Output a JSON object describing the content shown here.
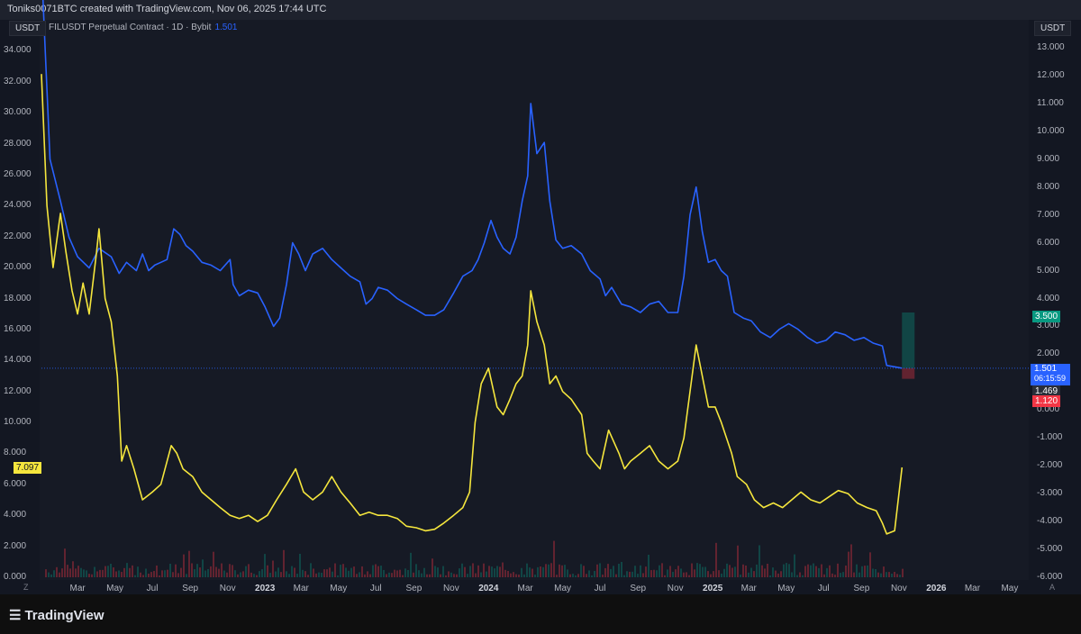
{
  "header": {
    "text": "Toniks0071BTC created with TradingView.com, Nov 06, 2025 17:44 UTC"
  },
  "symbol": {
    "name": "FILUSDT Perpetual Contract · 1D · Bybit",
    "last": "1.501"
  },
  "left_axis": {
    "unit": "USDT",
    "ticks": [
      "34.000",
      "32.000",
      "30.000",
      "28.000",
      "26.000",
      "24.000",
      "22.000",
      "20.000",
      "18.000",
      "16.000",
      "14.000",
      "12.000",
      "10.000",
      "8.000",
      "6.000",
      "4.000",
      "2.000",
      "0.000"
    ]
  },
  "right_axis": {
    "unit": "USDT",
    "ticks": [
      "13.000",
      "12.000",
      "11.000",
      "10.000",
      "9.000",
      "8.000",
      "7.000",
      "6.000",
      "5.000",
      "4.000",
      "3.000",
      "2.000",
      "1.000",
      "0.000",
      "-1.000",
      "-2.000",
      "-3.000",
      "-4.000",
      "-5.000",
      "-6.000"
    ]
  },
  "x_axis": {
    "corner_left": "Z",
    "corner_right": "A",
    "labels": [
      {
        "t": "Mar",
        "bold": false
      },
      {
        "t": "May",
        "bold": false
      },
      {
        "t": "Jul",
        "bold": false
      },
      {
        "t": "Sep",
        "bold": false
      },
      {
        "t": "Nov",
        "bold": false
      },
      {
        "t": "2023",
        "bold": true
      },
      {
        "t": "Mar",
        "bold": false
      },
      {
        "t": "May",
        "bold": false
      },
      {
        "t": "Jul",
        "bold": false
      },
      {
        "t": "Sep",
        "bold": false
      },
      {
        "t": "Nov",
        "bold": false
      },
      {
        "t": "2024",
        "bold": true
      },
      {
        "t": "Mar",
        "bold": false
      },
      {
        "t": "May",
        "bold": false
      },
      {
        "t": "Jul",
        "bold": false
      },
      {
        "t": "Sep",
        "bold": false
      },
      {
        "t": "Nov",
        "bold": false
      },
      {
        "t": "2025",
        "bold": true
      },
      {
        "t": "Mar",
        "bold": false
      },
      {
        "t": "May",
        "bold": false
      },
      {
        "t": "Jul",
        "bold": false
      },
      {
        "t": "Sep",
        "bold": false
      },
      {
        "t": "Nov",
        "bold": false
      },
      {
        "t": "2026",
        "bold": true
      },
      {
        "t": "Mar",
        "bold": false
      },
      {
        "t": "May",
        "bold": false
      }
    ]
  },
  "badges": {
    "left_yellow": "7.097",
    "target": "3.500",
    "price": "1.501",
    "countdown": "06:15:59",
    "entry": "1.469",
    "stop": "1.120"
  },
  "colors": {
    "blue": "#2962ff",
    "yellow": "#f5e63d",
    "green": "#089981",
    "red": "#f23645",
    "bg": "#131722"
  },
  "footer": {
    "brand": "TradingView"
  },
  "chart_data": {
    "type": "line",
    "x_range": [
      "2022-01-01",
      "2026-06-01"
    ],
    "series": [
      {
        "name": "FILUSDT Perpetual Contract · 1D · Bybit",
        "axis": "right",
        "points": [
          [
            "2022-01-01",
            16.0
          ],
          [
            "2022-01-15",
            9.0
          ],
          [
            "2022-02-01",
            7.5
          ],
          [
            "2022-02-15",
            6.2
          ],
          [
            "2022-03-01",
            5.5
          ],
          [
            "2022-03-20",
            5.1
          ],
          [
            "2022-04-05",
            5.8
          ],
          [
            "2022-04-25",
            5.5
          ],
          [
            "2022-05-08",
            4.9
          ],
          [
            "2022-05-20",
            5.3
          ],
          [
            "2022-06-05",
            5.0
          ],
          [
            "2022-06-15",
            5.6
          ],
          [
            "2022-06-25",
            5.0
          ],
          [
            "2022-07-05",
            5.2
          ],
          [
            "2022-07-15",
            5.3
          ],
          [
            "2022-07-25",
            5.4
          ],
          [
            "2022-08-05",
            6.5
          ],
          [
            "2022-08-15",
            6.3
          ],
          [
            "2022-08-25",
            5.9
          ],
          [
            "2022-09-05",
            5.7
          ],
          [
            "2022-09-20",
            5.3
          ],
          [
            "2022-10-05",
            5.2
          ],
          [
            "2022-10-20",
            5.0
          ],
          [
            "2022-11-05",
            5.4
          ],
          [
            "2022-11-10",
            4.5
          ],
          [
            "2022-11-20",
            4.1
          ],
          [
            "2022-12-05",
            4.3
          ],
          [
            "2022-12-20",
            4.2
          ],
          [
            "2023-01-01",
            3.7
          ],
          [
            "2023-01-15",
            3.0
          ],
          [
            "2023-01-25",
            3.3
          ],
          [
            "2023-02-05",
            4.5
          ],
          [
            "2023-02-15",
            6.0
          ],
          [
            "2023-02-25",
            5.6
          ],
          [
            "2023-03-08",
            5.0
          ],
          [
            "2023-03-20",
            5.6
          ],
          [
            "2023-04-05",
            5.8
          ],
          [
            "2023-04-20",
            5.4
          ],
          [
            "2023-05-05",
            5.1
          ],
          [
            "2023-05-20",
            4.8
          ],
          [
            "2023-06-05",
            4.6
          ],
          [
            "2023-06-15",
            3.8
          ],
          [
            "2023-06-25",
            4.0
          ],
          [
            "2023-07-05",
            4.4
          ],
          [
            "2023-07-20",
            4.3
          ],
          [
            "2023-08-05",
            4.0
          ],
          [
            "2023-08-20",
            3.8
          ],
          [
            "2023-09-05",
            3.6
          ],
          [
            "2023-09-20",
            3.4
          ],
          [
            "2023-10-05",
            3.4
          ],
          [
            "2023-10-20",
            3.6
          ],
          [
            "2023-11-05",
            4.2
          ],
          [
            "2023-11-20",
            4.8
          ],
          [
            "2023-12-05",
            5.0
          ],
          [
            "2023-12-15",
            5.4
          ],
          [
            "2023-12-25",
            6.0
          ],
          [
            "2024-01-05",
            6.8
          ],
          [
            "2024-01-15",
            6.2
          ],
          [
            "2024-01-25",
            5.8
          ],
          [
            "2024-02-05",
            5.6
          ],
          [
            "2024-02-15",
            6.2
          ],
          [
            "2024-02-25",
            7.5
          ],
          [
            "2024-03-05",
            8.4
          ],
          [
            "2024-03-10",
            11.0
          ],
          [
            "2024-03-20",
            9.2
          ],
          [
            "2024-04-01",
            9.6
          ],
          [
            "2024-04-10",
            7.5
          ],
          [
            "2024-04-20",
            6.1
          ],
          [
            "2024-05-01",
            5.8
          ],
          [
            "2024-05-15",
            5.9
          ],
          [
            "2024-06-01",
            5.6
          ],
          [
            "2024-06-15",
            5.0
          ],
          [
            "2024-07-01",
            4.7
          ],
          [
            "2024-07-10",
            4.1
          ],
          [
            "2024-07-20",
            4.4
          ],
          [
            "2024-08-05",
            3.8
          ],
          [
            "2024-08-20",
            3.7
          ],
          [
            "2024-09-05",
            3.5
          ],
          [
            "2024-09-20",
            3.8
          ],
          [
            "2024-10-05",
            3.9
          ],
          [
            "2024-10-20",
            3.5
          ],
          [
            "2024-11-05",
            3.5
          ],
          [
            "2024-11-15",
            4.8
          ],
          [
            "2024-11-25",
            7.0
          ],
          [
            "2024-12-05",
            8.0
          ],
          [
            "2024-12-15",
            6.4
          ],
          [
            "2024-12-25",
            5.3
          ],
          [
            "2025-01-05",
            5.4
          ],
          [
            "2025-01-15",
            5.0
          ],
          [
            "2025-01-25",
            4.8
          ],
          [
            "2025-02-05",
            3.5
          ],
          [
            "2025-02-20",
            3.3
          ],
          [
            "2025-03-05",
            3.2
          ],
          [
            "2025-03-20",
            2.8
          ],
          [
            "2025-04-05",
            2.6
          ],
          [
            "2025-04-20",
            2.9
          ],
          [
            "2025-05-05",
            3.1
          ],
          [
            "2025-05-20",
            2.9
          ],
          [
            "2025-06-05",
            2.6
          ],
          [
            "2025-06-20",
            2.4
          ],
          [
            "2025-07-05",
            2.5
          ],
          [
            "2025-07-20",
            2.8
          ],
          [
            "2025-08-05",
            2.7
          ],
          [
            "2025-08-20",
            2.5
          ],
          [
            "2025-09-05",
            2.6
          ],
          [
            "2025-09-20",
            2.4
          ],
          [
            "2025-10-05",
            2.3
          ],
          [
            "2025-10-12",
            1.6
          ],
          [
            "2025-10-25",
            1.55
          ],
          [
            "2025-11-06",
            1.501
          ]
        ]
      },
      {
        "name": "",
        "axis": "left",
        "points": [
          [
            "2022-01-01",
            32.5
          ],
          [
            "2022-01-10",
            24.0
          ],
          [
            "2022-01-20",
            20.0
          ],
          [
            "2022-02-01",
            23.5
          ],
          [
            "2022-02-10",
            21.0
          ],
          [
            "2022-02-20",
            18.5
          ],
          [
            "2022-03-01",
            17.0
          ],
          [
            "2022-03-10",
            19.0
          ],
          [
            "2022-03-20",
            17.0
          ],
          [
            "2022-04-01",
            21.0
          ],
          [
            "2022-04-05",
            22.5
          ],
          [
            "2022-04-15",
            18.0
          ],
          [
            "2022-04-25",
            16.5
          ],
          [
            "2022-05-05",
            13.0
          ],
          [
            "2022-05-12",
            7.5
          ],
          [
            "2022-05-20",
            8.5
          ],
          [
            "2022-06-01",
            7.0
          ],
          [
            "2022-06-15",
            5.0
          ],
          [
            "2022-07-01",
            5.5
          ],
          [
            "2022-07-15",
            6.0
          ],
          [
            "2022-08-01",
            8.5
          ],
          [
            "2022-08-10",
            8.0
          ],
          [
            "2022-08-20",
            7.0
          ],
          [
            "2022-09-05",
            6.5
          ],
          [
            "2022-09-20",
            5.5
          ],
          [
            "2022-10-05",
            5.0
          ],
          [
            "2022-10-20",
            4.5
          ],
          [
            "2022-11-05",
            4.0
          ],
          [
            "2022-11-20",
            3.8
          ],
          [
            "2022-12-05",
            4.0
          ],
          [
            "2022-12-20",
            3.6
          ],
          [
            "2023-01-05",
            4.0
          ],
          [
            "2023-01-20",
            5.0
          ],
          [
            "2023-02-05",
            6.0
          ],
          [
            "2023-02-20",
            7.0
          ],
          [
            "2023-03-05",
            5.5
          ],
          [
            "2023-03-20",
            5.0
          ],
          [
            "2023-04-05",
            5.5
          ],
          [
            "2023-04-20",
            6.5
          ],
          [
            "2023-05-05",
            5.5
          ],
          [
            "2023-05-20",
            4.8
          ],
          [
            "2023-06-05",
            4.0
          ],
          [
            "2023-06-20",
            4.2
          ],
          [
            "2023-07-05",
            4.0
          ],
          [
            "2023-07-20",
            4.0
          ],
          [
            "2023-08-05",
            3.8
          ],
          [
            "2023-08-20",
            3.3
          ],
          [
            "2023-09-05",
            3.2
          ],
          [
            "2023-09-20",
            3.0
          ],
          [
            "2023-10-05",
            3.1
          ],
          [
            "2023-10-20",
            3.5
          ],
          [
            "2023-11-05",
            4.0
          ],
          [
            "2023-11-20",
            4.5
          ],
          [
            "2023-12-01",
            5.5
          ],
          [
            "2023-12-10",
            10.0
          ],
          [
            "2023-12-20",
            12.5
          ],
          [
            "2024-01-01",
            13.5
          ],
          [
            "2024-01-15",
            11.0
          ],
          [
            "2024-01-25",
            10.5
          ],
          [
            "2024-02-05",
            11.5
          ],
          [
            "2024-02-15",
            12.5
          ],
          [
            "2024-02-25",
            13.0
          ],
          [
            "2024-03-05",
            15.0
          ],
          [
            "2024-03-10",
            18.5
          ],
          [
            "2024-03-20",
            16.5
          ],
          [
            "2024-04-01",
            15.0
          ],
          [
            "2024-04-10",
            12.5
          ],
          [
            "2024-04-20",
            13.0
          ],
          [
            "2024-05-01",
            12.0
          ],
          [
            "2024-05-15",
            11.5
          ],
          [
            "2024-06-01",
            10.5
          ],
          [
            "2024-06-10",
            8.0
          ],
          [
            "2024-06-20",
            7.5
          ],
          [
            "2024-07-01",
            7.0
          ],
          [
            "2024-07-15",
            9.5
          ],
          [
            "2024-08-01",
            8.0
          ],
          [
            "2024-08-10",
            7.0
          ],
          [
            "2024-08-20",
            7.5
          ],
          [
            "2024-09-05",
            8.0
          ],
          [
            "2024-09-20",
            8.5
          ],
          [
            "2024-10-05",
            7.5
          ],
          [
            "2024-10-20",
            7.0
          ],
          [
            "2024-11-05",
            7.5
          ],
          [
            "2024-11-15",
            9.0
          ],
          [
            "2024-11-25",
            12.0
          ],
          [
            "2024-12-05",
            15.0
          ],
          [
            "2024-12-15",
            13.0
          ],
          [
            "2024-12-25",
            11.0
          ],
          [
            "2025-01-05",
            11.0
          ],
          [
            "2025-01-15",
            10.0
          ],
          [
            "2025-02-01",
            8.0
          ],
          [
            "2025-02-10",
            6.5
          ],
          [
            "2025-02-25",
            6.0
          ],
          [
            "2025-03-10",
            5.0
          ],
          [
            "2025-03-25",
            4.5
          ],
          [
            "2025-04-10",
            4.8
          ],
          [
            "2025-04-25",
            4.5
          ],
          [
            "2025-05-10",
            5.0
          ],
          [
            "2025-05-25",
            5.5
          ],
          [
            "2025-06-10",
            5.0
          ],
          [
            "2025-06-25",
            4.8
          ],
          [
            "2025-07-10",
            5.2
          ],
          [
            "2025-07-25",
            5.6
          ],
          [
            "2025-08-10",
            5.4
          ],
          [
            "2025-08-25",
            4.8
          ],
          [
            "2025-09-10",
            4.5
          ],
          [
            "2025-09-25",
            4.3
          ],
          [
            "2025-10-05",
            3.5
          ],
          [
            "2025-10-12",
            2.8
          ],
          [
            "2025-10-25",
            3.0
          ],
          [
            "2025-11-06",
            7.097
          ]
        ]
      }
    ],
    "left_ylim": [
      0,
      36
    ],
    "right_ylim": [
      -6,
      14
    ],
    "grid": false
  }
}
